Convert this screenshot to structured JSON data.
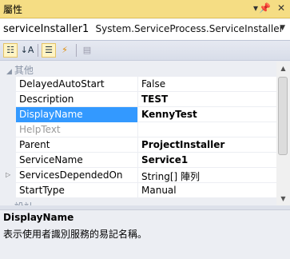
{
  "window": {
    "title": "屬性"
  },
  "object_selector": {
    "name": "serviceInstaller1",
    "type": "System.ServiceProcess.ServiceInstaller"
  },
  "toolbar": {
    "categorized": "categorized-icon",
    "alphabetical": "alphabetical-icon",
    "properties": "properties-icon",
    "events": "events-icon",
    "property_pages": "property-pages-icon"
  },
  "grid": {
    "category_top": "其他",
    "category_bottom": "設計",
    "properties": [
      {
        "name": "DelayedAutoStart",
        "value": "False"
      },
      {
        "name": "Description",
        "value": "TEST"
      },
      {
        "name": "DisplayName",
        "value": "KennyTest"
      },
      {
        "name": "HelpText",
        "value": ""
      },
      {
        "name": "Parent",
        "value": "ProjectInstaller"
      },
      {
        "name": "ServiceName",
        "value": "Service1"
      },
      {
        "name": "ServicesDependedOn",
        "value": "String[] 陣列"
      },
      {
        "name": "StartType",
        "value": "Manual"
      }
    ]
  },
  "description": {
    "title": "DisplayName",
    "text": "表示使用者識別服務的易記名稱。"
  },
  "colors": {
    "titlebar": "#f5dd84",
    "selection": "#3399ff",
    "toolbar_active": "#fff4c4"
  }
}
